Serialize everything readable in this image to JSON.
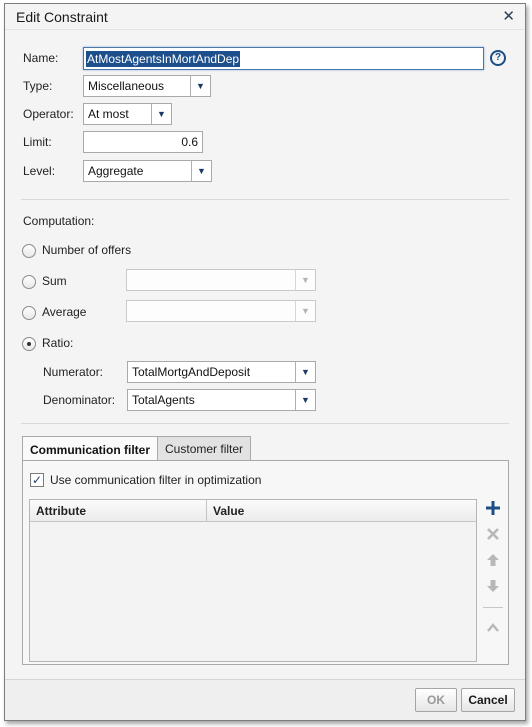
{
  "dialog": {
    "title": "Edit Constraint",
    "close_glyph": "✕"
  },
  "form": {
    "name_label": "Name:",
    "name_value": "AtMostAgentsInMortAndDep",
    "help_glyph": "?",
    "type_label": "Type:",
    "type_value": "Miscellaneous",
    "operator_label": "Operator:",
    "operator_value": "At most",
    "limit_label": "Limit:",
    "limit_value": "0.6",
    "level_label": "Level:",
    "level_value": "Aggregate"
  },
  "computation": {
    "heading": "Computation:",
    "options": [
      {
        "label": "Number of offers",
        "checked": false
      },
      {
        "label": "Sum",
        "checked": false
      },
      {
        "label": "Average",
        "checked": false
      },
      {
        "label": "Ratio:",
        "checked": true
      }
    ],
    "sum_value": "",
    "average_value": "",
    "numerator_label": "Numerator:",
    "numerator_value": "TotalMortgAndDeposit",
    "denominator_label": "Denominator:",
    "denominator_value": "TotalAgents"
  },
  "tabs": [
    {
      "label": "Communication filter",
      "active": true
    },
    {
      "label": "Customer filter",
      "active": false
    }
  ],
  "filter": {
    "checkbox_label": "Use communication filter in optimization",
    "checked": true,
    "columns": [
      "Attribute",
      "Value"
    ],
    "rows": []
  },
  "side_actions": [
    {
      "icon": "plus-icon",
      "enabled": true
    },
    {
      "icon": "delete-icon",
      "enabled": false
    },
    {
      "icon": "move-up-icon",
      "enabled": false
    },
    {
      "icon": "move-down-icon",
      "enabled": false
    },
    {
      "icon": "collapse-icon",
      "enabled": false
    }
  ],
  "footer": {
    "ok_label": "OK",
    "cancel_label": "Cancel"
  },
  "colors": {
    "accent": "#1b4d86",
    "selection": "#1d4f8c",
    "disabled_icon": "#b8b8b8"
  }
}
